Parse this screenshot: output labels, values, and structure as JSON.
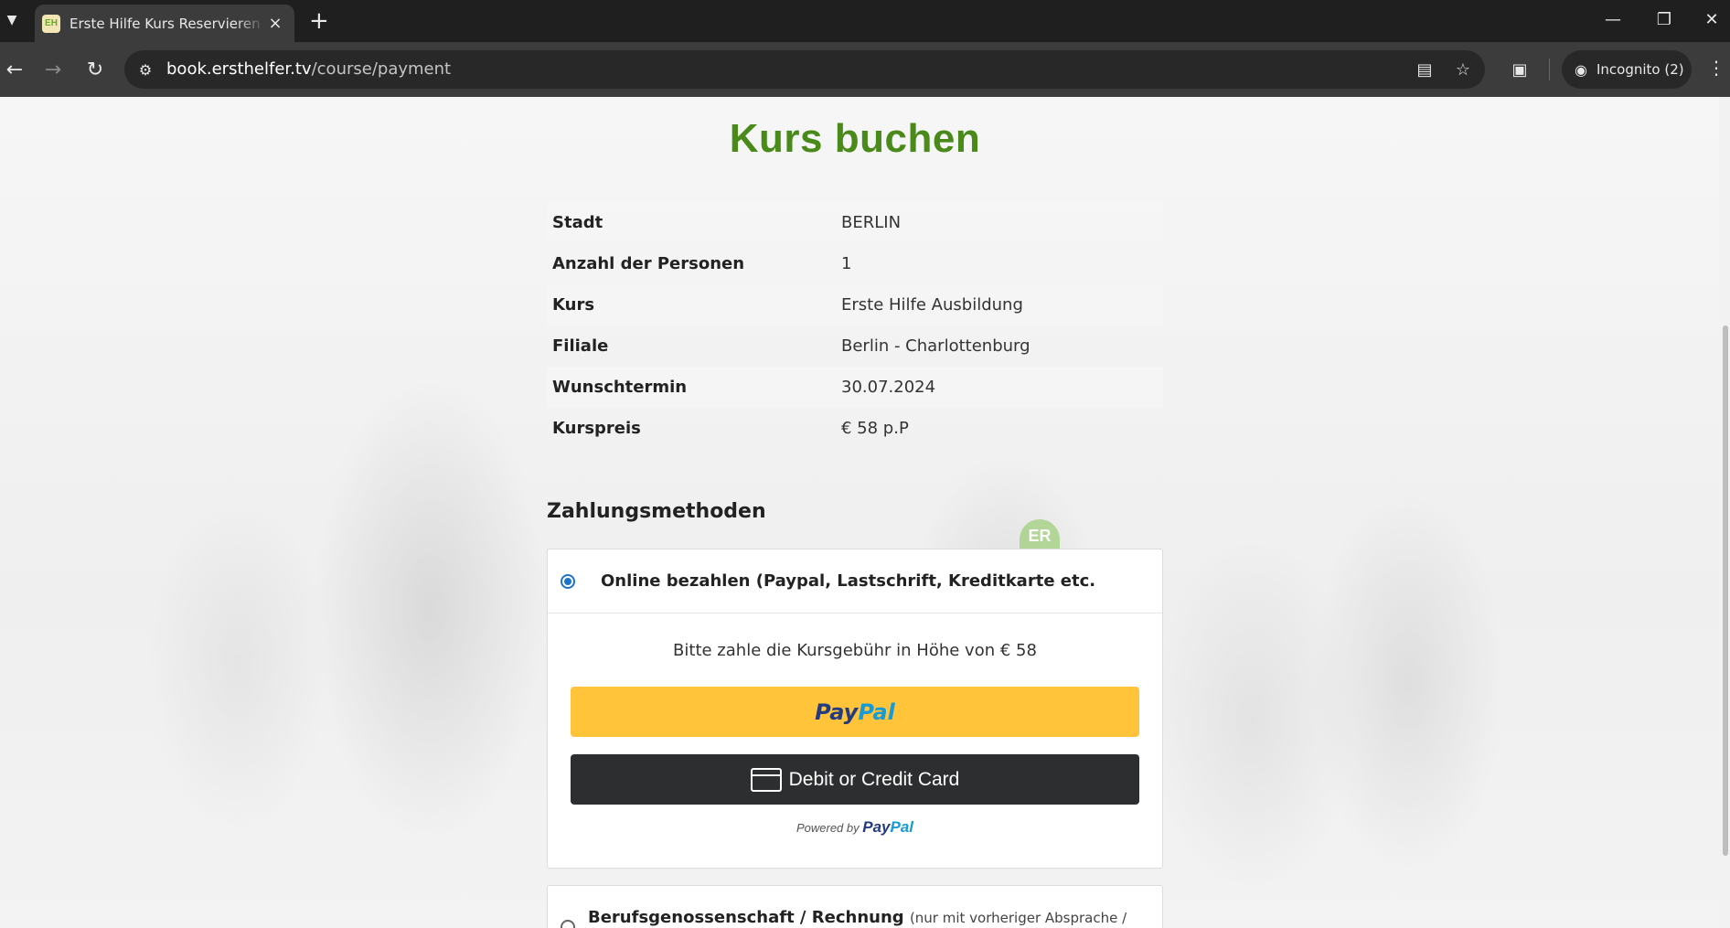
{
  "browser": {
    "tab_title": "Erste Hilfe Kurs Reservieren - Online",
    "url_host": "book.ersthelfer.tv",
    "url_path": "/course/payment",
    "incognito_label": "Incognito (2)"
  },
  "page": {
    "heading": "Kurs buchen",
    "details": [
      {
        "label": "Stadt",
        "value": "BERLIN"
      },
      {
        "label": "Anzahl der Personen",
        "value": "1"
      },
      {
        "label": "Kurs",
        "value": "Erste Hilfe Ausbildung"
      },
      {
        "label": "Filiale",
        "value": "Berlin - Charlottenburg"
      },
      {
        "label": "Wunschtermin",
        "value": "30.07.2024"
      },
      {
        "label": "Kurspreis",
        "value": "€ 58 p.P"
      }
    ],
    "payment_heading": "Zahlungsmethoden",
    "payment_options": [
      {
        "label": "Online bezahlen (Paypal, Lastschrift, Kreditkarte etc.",
        "selected": true
      },
      {
        "label": "Berufsgenossenschaft / Rechnung",
        "note": "(nur mit vorheriger Absprache /",
        "selected": false
      }
    ],
    "pay_instruction": "Bitte zahle die Kursgebühr in Höhe von € 58",
    "paypal_button": {
      "part1": "Pay",
      "part2": "Pal"
    },
    "card_button_label": "Debit or Credit Card",
    "powered_by": "Powered by",
    "powered_brand_a": "Pay",
    "powered_brand_b": "Pal",
    "logo_badge_text": "ER"
  },
  "colors": {
    "heading_green": "#4a8a1a",
    "paypal_yellow": "#ffc439",
    "card_button_dark": "#2c2e2f",
    "radio_blue": "#1a73c8"
  }
}
